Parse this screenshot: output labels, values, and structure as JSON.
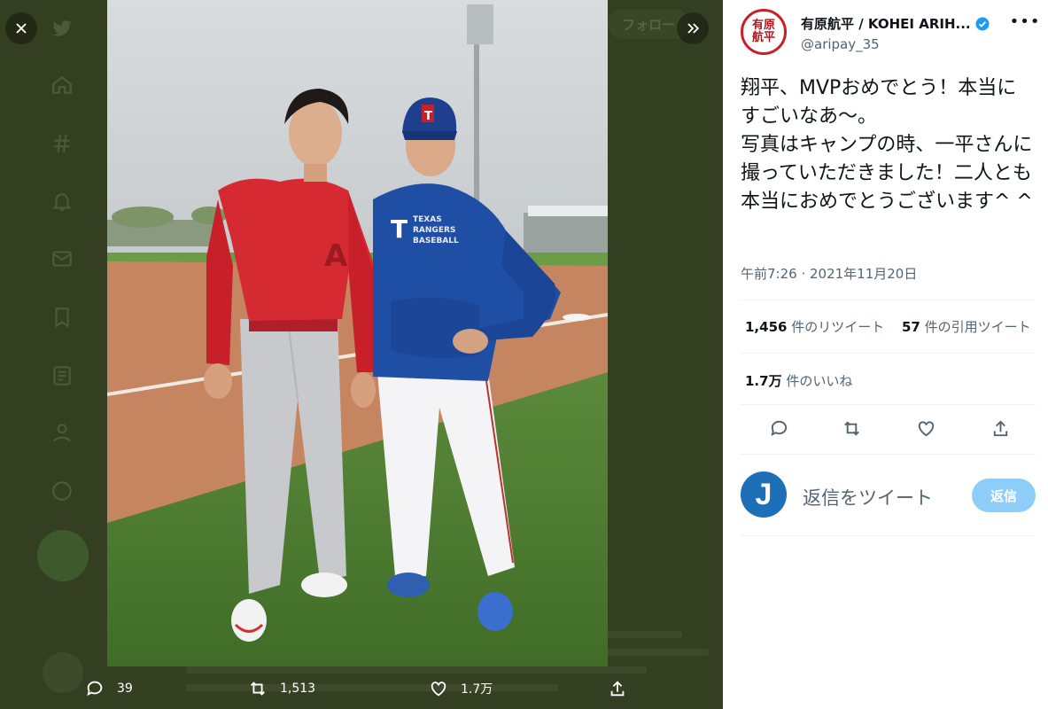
{
  "background": {
    "follow_label": "フォロー"
  },
  "photo_actions": {
    "reply_count": "39",
    "retweet_count": "1,513",
    "like_count": "1.7万"
  },
  "tweet": {
    "display_name": "有原航平 / KOHEI ARIH...",
    "handle": "@aripay_35",
    "avatar_seal": "有原航平",
    "text": "翔平、MVPおめでとう！本当にすごいなあ〜。\n写真はキャンプの時、一平さんに撮っていただきました！二人とも本当におめでとうございます^ ^",
    "timestamp": "午前7:26 · 2021年11月20日",
    "retweets_value": "1,456",
    "retweets_label": "件のリツイート",
    "quotes_value": "57",
    "quotes_label": "件の引用ツイート",
    "likes_value": "1.7万",
    "likes_label": "件のいいね"
  },
  "reply": {
    "avatar_letter": "J",
    "placeholder": "返信をツイート",
    "button_label": "返信"
  },
  "colors": {
    "accent": "#1d9bf0",
    "reply_button": "#8ecdf8",
    "seal_red": "#c91f26"
  },
  "photo": {
    "jersey_left_text": "A",
    "jersey_right_text": "TEXAS RANGERS BASEBALL"
  }
}
